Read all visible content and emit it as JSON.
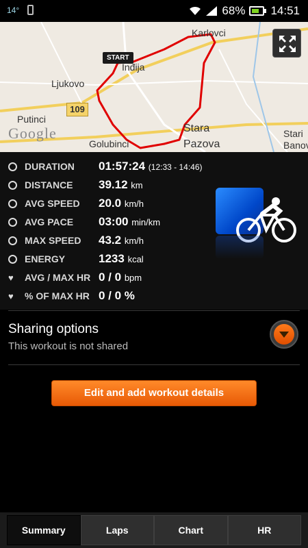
{
  "status_bar": {
    "temperature": "14°",
    "battery_percent": "68%",
    "time": "14:51"
  },
  "map": {
    "labels": {
      "karlovci": "Karlovci",
      "ljukovo": "Ljukovo",
      "inđija": "Inđija",
      "putinci": "Putinci",
      "stara": "Stara",
      "pazova": "Pazova",
      "golubinci": "Golubinci",
      "stari": "Stari",
      "banov": "Banov"
    },
    "road_number": "109",
    "provider": "Google",
    "start_label": "START",
    "route_color": "#e00000"
  },
  "stats": {
    "duration": {
      "label": "DURATION",
      "value": "01:57:24",
      "unit": "(12:33 - 14:46)"
    },
    "distance": {
      "label": "DISTANCE",
      "value": "39.12",
      "unit": "km"
    },
    "avg_speed": {
      "label": "AVG SPEED",
      "value": "20.0",
      "unit": "km/h"
    },
    "avg_pace": {
      "label": "AVG PACE",
      "value": "03:00",
      "unit": "min/km"
    },
    "max_speed": {
      "label": "MAX SPEED",
      "value": "43.2",
      "unit": "km/h"
    },
    "energy": {
      "label": "ENERGY",
      "value": "1233",
      "unit": "kcal"
    },
    "avg_max_hr": {
      "label": "AVG / MAX HR",
      "value": "0 / 0",
      "unit": "bpm"
    },
    "pct_max_hr": {
      "label": "% OF MAX HR",
      "value": "0 / 0 %",
      "unit": ""
    }
  },
  "sport_icon": "cycling-icon",
  "sharing": {
    "title": "Sharing options",
    "subtitle": "This workout is not shared"
  },
  "edit_button_label": "Edit and add workout details",
  "tabs": [
    {
      "label": "Summary",
      "active": true
    },
    {
      "label": "Laps",
      "active": false
    },
    {
      "label": "Chart",
      "active": false
    },
    {
      "label": "HR",
      "active": false
    }
  ],
  "colors": {
    "accent_orange": "#f06a10",
    "sport_tile_blue": "#0047c9"
  }
}
